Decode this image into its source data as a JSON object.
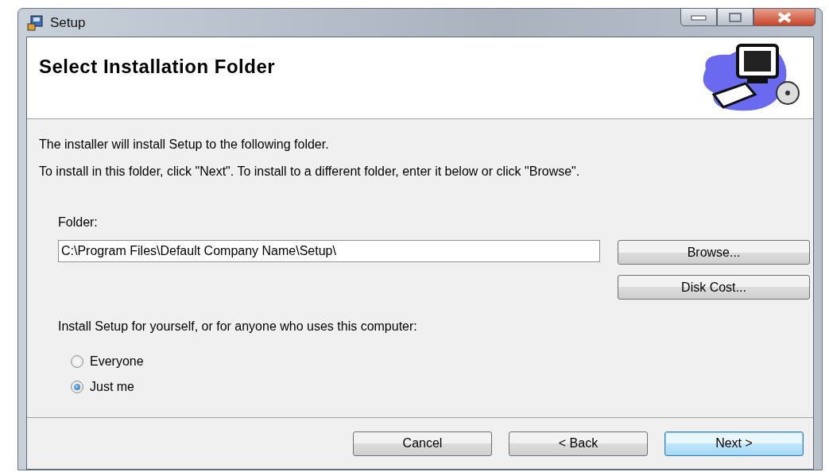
{
  "window": {
    "title": "Setup"
  },
  "header": {
    "title": "Select Installation Folder"
  },
  "intro": [
    "The installer will install Setup to the following folder.",
    "To install in this folder, click \"Next\". To install to a different folder, enter it below or click \"Browse\"."
  ],
  "folder": {
    "label": "Folder:",
    "value": "C:\\Program Files\\Default Company Name\\Setup\\"
  },
  "folder_buttons": [
    "Browse...",
    "Disk Cost..."
  ],
  "scope": {
    "label": "Install Setup for yourself, or for anyone who uses this computer:",
    "options": [
      {
        "label": "Everyone",
        "selected": false
      },
      {
        "label": "Just me",
        "selected": true
      }
    ]
  },
  "buttons": [
    {
      "label": "Cancel",
      "kind": "normal"
    },
    {
      "label": "< Back",
      "kind": "normal"
    },
    {
      "label": "Next >",
      "kind": "default"
    }
  ]
}
